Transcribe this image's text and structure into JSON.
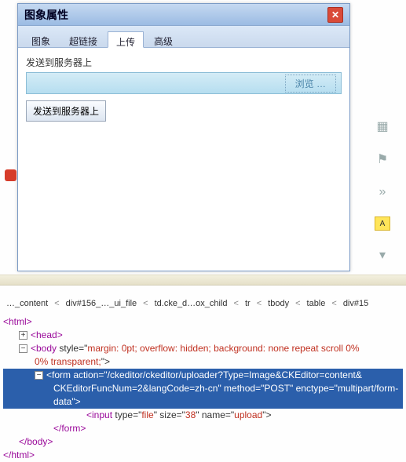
{
  "dialog": {
    "title": "图象属性",
    "close": "✕",
    "tabs": [
      "图象",
      "超链接",
      "上传",
      "高级"
    ],
    "active_tab": 2,
    "upload_label": "发送到服务器上",
    "browse_button": "浏览 …",
    "send_button": "发送到服务器上"
  },
  "right_icons": {
    "chart": "▦",
    "flag": "⚑",
    "chevrons": "»",
    "a_badge": "A",
    "dash": "▾"
  },
  "breadcrumb": {
    "items": [
      "…_content",
      "div#156_…_ui_file",
      "td.cke_d…ox_child",
      "tr",
      "tbody",
      "table",
      "div#15"
    ]
  },
  "code": {
    "l1": "<html>",
    "l2_toggle": "+",
    "l2": "<head>",
    "l3_toggle": "−",
    "l3a": "<body ",
    "l3b": "style",
    "l3c": "=\"",
    "l3d": "margin: 0pt; overflow: hidden; background: none repeat scroll 0%",
    "l3e": "0% transparent;",
    "l3f": "\">",
    "l4_toggle": "−",
    "l4a": "<form ",
    "l4b": "action",
    "l4c": "=\"",
    "l4d": "/ckeditor/ckeditor/uploader?Type=Image&CKEditor=content&",
    "l4e": "CKEditorFuncNum=2&langCode=zh-cn",
    "l4f": "\" ",
    "l4g": "method",
    "l4h": "=\"",
    "l4i": "POST",
    "l4j": "\" ",
    "l4k": "enctype",
    "l4l": "=\"",
    "l4m": "multipart/form-",
    "l4n": "data",
    "l4o": "\">",
    "l5a": "<input ",
    "l5b": "type",
    "l5c": "=\"",
    "l5d": "file",
    "l5e": "\" ",
    "l5f": "size",
    "l5g": "=\"",
    "l5h": "38",
    "l5i": "\" ",
    "l5j": "name",
    "l5k": "=\"",
    "l5l": "upload",
    "l5m": "\">",
    "l6": "</form>",
    "l7": "</body>",
    "l8": "</html>"
  }
}
